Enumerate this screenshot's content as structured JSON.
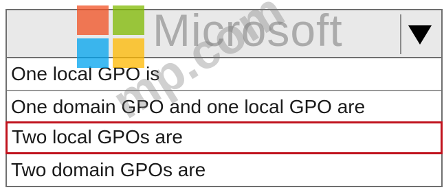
{
  "dropdown": {
    "selected_value": "",
    "arrow_icon": "triangle-down-icon",
    "options": [
      {
        "label": "One local GPO is",
        "highlighted": false
      },
      {
        "label": "One domain GPO and one local GPO are",
        "highlighted": false
      },
      {
        "label": "Two local GPOs are",
        "highlighted": true
      },
      {
        "label": "Two domain GPOs are",
        "highlighted": false
      }
    ],
    "highlight_color": "#c0121d"
  },
  "watermark": {
    "brand_text": "Microsoft",
    "diagonal_text": "mp.com",
    "logo_colors": [
      "#f25022",
      "#7fba00",
      "#00a4ef",
      "#ffb900"
    ]
  }
}
